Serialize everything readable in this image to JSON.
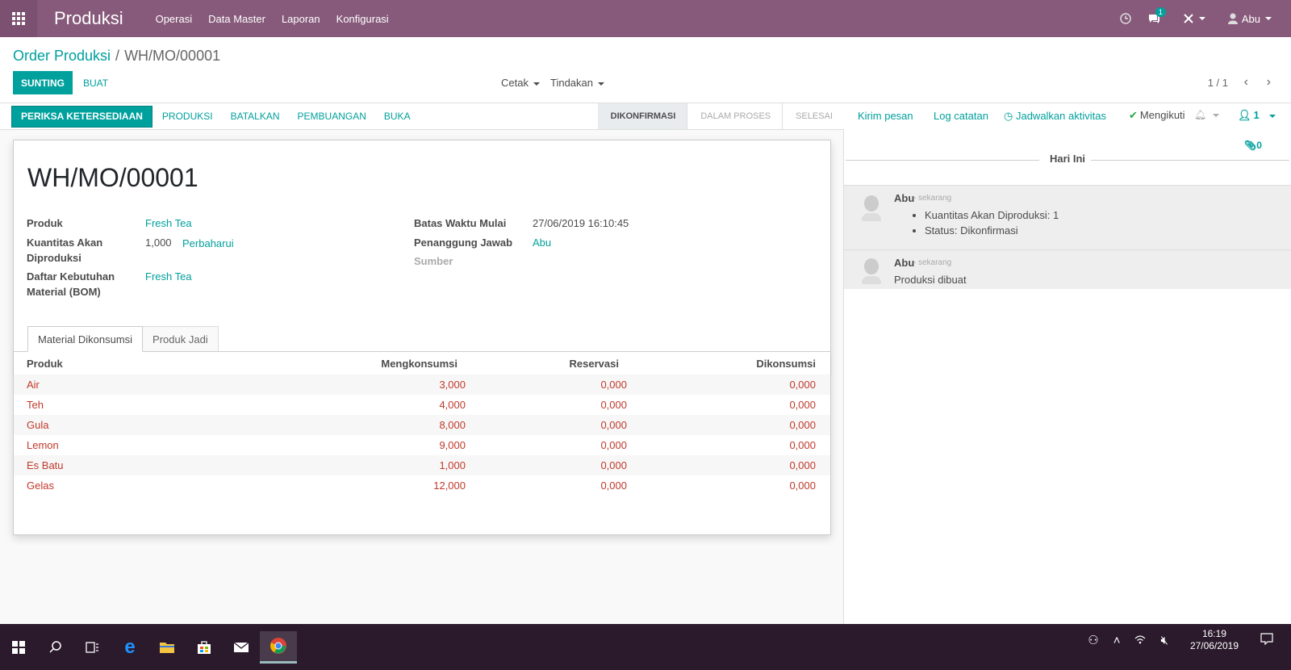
{
  "navbar": {
    "brand": "Produksi",
    "menu": [
      "Operasi",
      "Data Master",
      "Laporan",
      "Konfigurasi"
    ],
    "message_count": "1",
    "user": "Abu"
  },
  "control_panel": {
    "breadcrumb_parent": "Order Produksi",
    "breadcrumb_sep": "/",
    "breadcrumb_current": "WH/MO/00001",
    "edit_label": "SUNTING",
    "create_label": "BUAT",
    "print_label": "Cetak",
    "action_label": "Tindakan",
    "pager": "1 / 1"
  },
  "statusbar": {
    "buttons": [
      "PERIKSA KETERSEDIAAN",
      "PRODUKSI",
      "BATALKAN",
      "PEMBUANGAN",
      "BUKA"
    ],
    "stages": [
      "DIKONFIRMASI",
      "DALAM PROSES",
      "SELESAI"
    ],
    "active_stage": "DIKONFIRMASI"
  },
  "form": {
    "title": "WH/MO/00001",
    "product_label": "Produk",
    "product_value": "Fresh Tea",
    "qty_label_1": "Kuantitas Akan",
    "qty_label_2": "Diproduksi",
    "qty_value": "1,000",
    "qty_update": "Perbaharui",
    "bom_label_1": "Daftar Kebutuhan",
    "bom_label_2": "Material (BOM)",
    "bom_value": "Fresh Tea",
    "deadline_label": "Batas Waktu Mulai",
    "deadline_value": "27/06/2019 16:10:45",
    "responsible_label": "Penanggung Jawab",
    "responsible_value": "Abu",
    "source_label": "Sumber",
    "tabs": [
      "Material Dikonsumsi",
      "Produk Jadi"
    ]
  },
  "table": {
    "headers": [
      "Produk",
      "Mengkonsumsi",
      "Reservasi",
      "Dikonsumsi"
    ],
    "rows": [
      [
        "Air",
        "3,000",
        "0,000",
        "0,000"
      ],
      [
        "Teh",
        "4,000",
        "0,000",
        "0,000"
      ],
      [
        "Gula",
        "8,000",
        "0,000",
        "0,000"
      ],
      [
        "Lemon",
        "9,000",
        "0,000",
        "0,000"
      ],
      [
        "Es Batu",
        "1,000",
        "0,000",
        "0,000"
      ],
      [
        "Gelas",
        "12,000",
        "0,000",
        "0,000"
      ]
    ]
  },
  "chatter": {
    "send_message": "Kirim pesan",
    "log_note": "Log catatan",
    "schedule": "Jadwalkan aktivitas",
    "following": "Mengikuti",
    "followers_count": "1",
    "attachments_count": "0",
    "today": "Hari Ini",
    "messages": [
      {
        "author": "Abu",
        "time": "- sekarang",
        "items": [
          "Kuantitas Akan Diproduksi: 1",
          "Status: Dikonfirmasi"
        ]
      },
      {
        "author": "Abu",
        "time": "- sekarang",
        "body": "Produksi dibuat"
      }
    ]
  },
  "taskbar": {
    "time": "16:19",
    "date": "27/06/2019"
  },
  "colors": {
    "brand": "#875A7B",
    "accent": "#00A09D",
    "danger_text": "#c0392b"
  }
}
